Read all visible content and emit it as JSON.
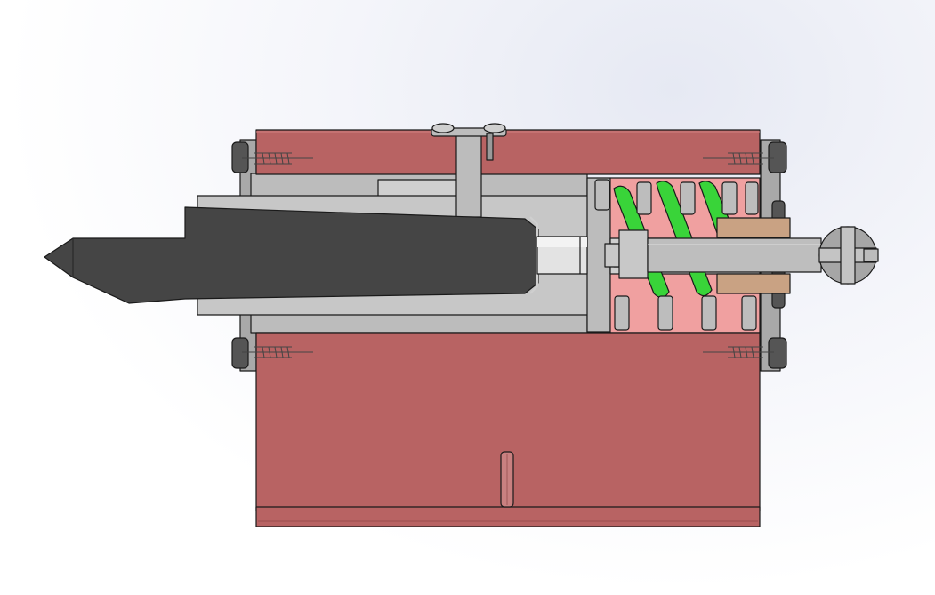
{
  "scene": {
    "view": "section-view",
    "description_label": "",
    "colors": {
      "background": "#f5f6fa",
      "housing": "#b86363",
      "housing_dark": "#9a4d4d",
      "steel": "#bcbcbc",
      "steel_light": "#d4d4d4",
      "steel_dark": "#8e8e8e",
      "tool": "#454545",
      "spring": "#39d439",
      "spring_cavity": "#f0a0a0",
      "bushing": "#c9a283",
      "outline": "#1a1a1a"
    },
    "parts": [
      {
        "id": "top-cover",
        "icon": "housing-block"
      },
      {
        "id": "base-housing",
        "icon": "housing-block"
      },
      {
        "id": "center-punch-tool",
        "icon": "cutting-tool"
      },
      {
        "id": "plunger",
        "icon": "shaft"
      },
      {
        "id": "compression-spring",
        "icon": "coil-spring"
      },
      {
        "id": "adjustment-knob",
        "icon": "knob"
      },
      {
        "id": "locating-pin",
        "icon": "pin"
      },
      {
        "id": "set-screw",
        "icon": "screw"
      },
      {
        "id": "cap-screws",
        "icon": "screw"
      }
    ]
  }
}
